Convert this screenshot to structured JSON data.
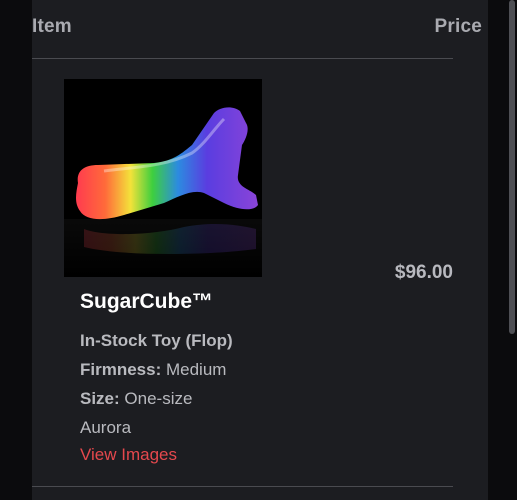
{
  "cart": {
    "headers": {
      "item": "Item",
      "price": "Price"
    },
    "line_item": {
      "name": "SugarCube™",
      "stock_status": "In-Stock Toy (Flop)",
      "firmness_label": "Firmness:",
      "firmness_value": "Medium",
      "size_label": "Size:",
      "size_value": "One-size",
      "variant": "Aurora",
      "price": "$96.00",
      "view_images_label": "View Images",
      "image_subject": "rainbow gradient toy photo"
    }
  },
  "colors": {
    "panel_bg": "#1c1d21",
    "page_bg": "#0b0b0d",
    "link": "#e5484d",
    "muted_text": "#b9babf"
  }
}
